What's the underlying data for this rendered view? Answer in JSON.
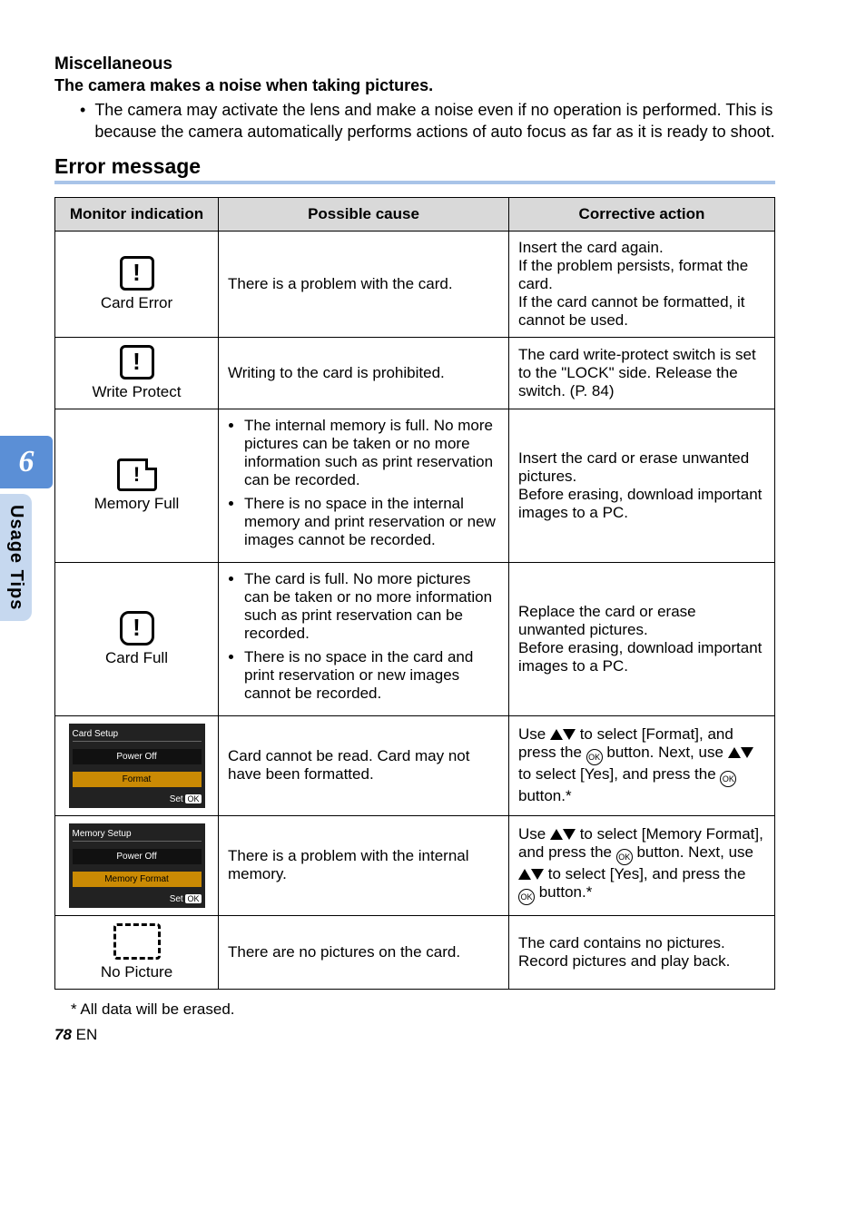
{
  "side": {
    "chapter_num": "6",
    "label": "Usage Tips"
  },
  "misc": {
    "heading": "Miscellaneous",
    "subhead": "The camera makes a noise when taking pictures.",
    "bullet": "The camera may activate the lens and make a noise even if no operation is performed. This is because the camera automatically performs actions of auto focus as far as it is ready to shoot."
  },
  "error": {
    "title": "Error message",
    "headers": {
      "mon": "Monitor indication",
      "cause": "Possible cause",
      "action": "Corrective action"
    },
    "rows": {
      "card_error": {
        "label": "Card Error",
        "cause": "There is a problem with the card.",
        "action": "Insert the card again.\nIf the problem persists, format the card.\nIf the card cannot be formatted, it cannot be used."
      },
      "write_protect": {
        "label": "Write Protect",
        "cause": "Writing to the card is prohibited.",
        "action": "The card write-protect switch is set to the \"LOCK\" side. Release the switch. (P. 84)"
      },
      "memory_full": {
        "label": "Memory Full",
        "cause_items": [
          "The internal memory is full. No more pictures can be taken or no more information such as print reservation can be recorded.",
          "There is no space in the internal memory and print reservation or new images cannot be recorded."
        ],
        "action": "Insert the card or erase unwanted pictures.\nBefore erasing, download important images to a PC."
      },
      "card_full": {
        "label": "Card Full",
        "cause_items": [
          "The card is full. No more pictures can be taken or no more information such as print reservation can be recorded.",
          "There is no space in the card and print reservation or new images cannot be recorded."
        ],
        "action": "Replace the card or erase unwanted pictures.\nBefore erasing, download important images to a PC."
      },
      "card_setup": {
        "screen": {
          "title": "Card Setup",
          "row1": "Power Off",
          "row2": "Format",
          "foot_prefix": "Set",
          "foot_pill": "OK"
        },
        "cause": "Card cannot be read. Card may not have been formatted.",
        "action_pre": "Use ",
        "action_mid1": " to select [Format], and press the ",
        "action_mid2": " button. Next, use ",
        "action_mid3": " to select [Yes], and press the ",
        "action_end": " button.*"
      },
      "memory_setup": {
        "screen": {
          "title": "Memory Setup",
          "row1": "Power Off",
          "row2": "Memory Format",
          "foot_prefix": "Set",
          "foot_pill": "OK"
        },
        "cause": "There is a problem with the internal memory.",
        "action_pre": "Use ",
        "action_mid1": " to select [Memory Format], and press the ",
        "action_mid2": " button. Next, use ",
        "action_mid3": " to select [Yes], and press the ",
        "action_end": " button.*"
      },
      "no_picture": {
        "label": "No Picture",
        "cause": "There are no pictures on the card.",
        "action": "The card contains no pictures. Record pictures and play back."
      }
    },
    "footnote": "*  All data will be erased."
  },
  "footer": {
    "page": "78",
    "lang": "EN"
  },
  "ok_label": "OK"
}
